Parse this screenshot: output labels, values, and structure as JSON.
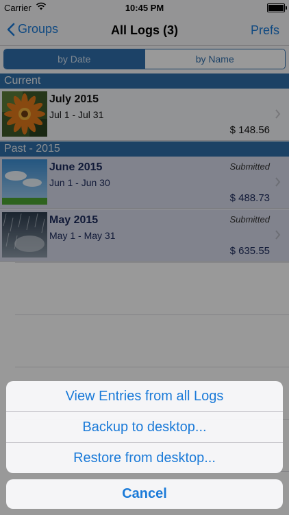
{
  "status_bar": {
    "carrier": "Carrier",
    "time": "10:45 PM"
  },
  "nav": {
    "back_label": "Groups",
    "title": "All Logs (3)",
    "right_label": "Prefs"
  },
  "segments": [
    {
      "label": "by Date",
      "selected": true
    },
    {
      "label": "by Name",
      "selected": false
    }
  ],
  "sections": [
    {
      "header": "Current",
      "rows": [
        {
          "title": "July 2015",
          "range": "Jul 1 - Jul 31",
          "amount": "$ 148.56",
          "status": "",
          "thumb_icon": "flower-photo"
        }
      ]
    },
    {
      "header": "Past - 2015",
      "rows": [
        {
          "title": "June 2015",
          "range": "Jun 1 - Jun 30",
          "amount": "$ 488.73",
          "status": "Submitted",
          "thumb_icon": "sky-photo"
        },
        {
          "title": "May 2015",
          "range": "May 1 - May 31",
          "amount": "$ 635.55",
          "status": "Submitted",
          "thumb_icon": "rain-photo"
        }
      ]
    }
  ],
  "action_sheet": {
    "options": [
      "View Entries from all Logs",
      "Backup to desktop...",
      "Restore from desktop..."
    ],
    "cancel_label": "Cancel"
  },
  "colors": {
    "accent": "#1a7ad8",
    "section_header": "#2f6fa8",
    "segment": "#2f6eac"
  }
}
